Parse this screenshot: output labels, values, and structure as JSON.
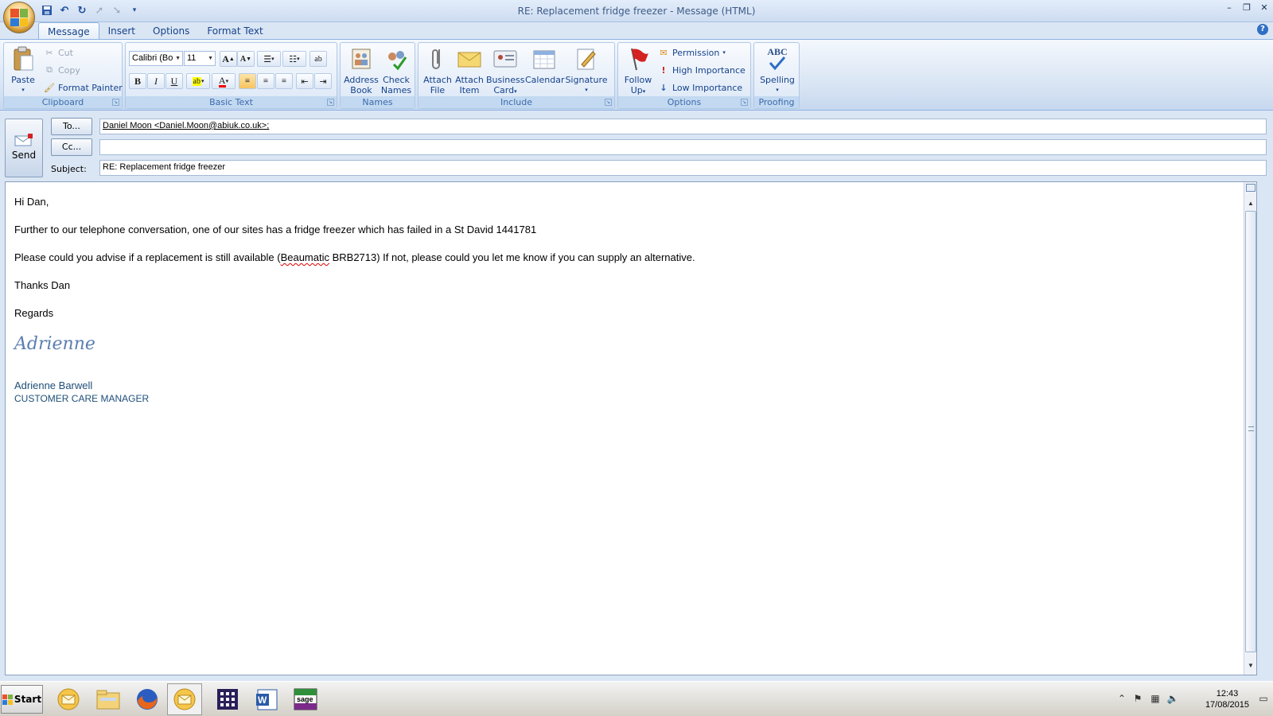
{
  "window": {
    "title": "RE: Replacement fridge freezer - Message (HTML)"
  },
  "qat": {
    "icons": [
      "save-icon",
      "undo-icon",
      "redo-icon",
      "up-arrow-icon",
      "down-arrow-icon",
      "customize-qat-icon"
    ]
  },
  "tabs": [
    "Message",
    "Insert",
    "Options",
    "Format Text"
  ],
  "ribbon": {
    "clipboard": {
      "label": "Clipboard",
      "paste": "Paste",
      "cut": "Cut",
      "copy": "Copy",
      "format_painter": "Format Painter"
    },
    "basic_text": {
      "label": "Basic Text",
      "font": "Calibri (Bo",
      "size": "11"
    },
    "names": {
      "label": "Names",
      "address_book": [
        "Address",
        "Book"
      ],
      "check_names": [
        "Check",
        "Names"
      ]
    },
    "include": {
      "label": "Include",
      "attach_file": [
        "Attach",
        "File"
      ],
      "attach_item": [
        "Attach",
        "Item"
      ],
      "business_card": [
        "Business",
        "Card"
      ],
      "calendar": "Calendar",
      "signature": "Signature"
    },
    "options": {
      "label": "Options",
      "follow_up": [
        "Follow",
        "Up"
      ],
      "permission": "Permission",
      "high_importance": "High Importance",
      "low_importance": "Low Importance"
    },
    "proofing": {
      "label": "Proofing",
      "spelling": "Spelling",
      "abc": "ABC"
    }
  },
  "header": {
    "send": "Send",
    "to_btn": "To...",
    "cc_btn": "Cc...",
    "subject_label": "Subject:",
    "to_value": "Daniel Moon <Daniel.Moon@abiuk.co.uk>;",
    "cc_value": "",
    "subject_value": "RE: Replacement fridge freezer"
  },
  "body": {
    "greeting": "Hi Dan,",
    "para1": "Further to our telephone conversation, one of our sites has a fridge freezer which has failed in a St David 1441781",
    "para2_pre": "Please could you advise if a replacement is still available (",
    "para2_misspelled": "Beaumatic",
    "para2_post": " BRB2713)  If not, please could you let me know if you can supply an  alternative.",
    "thanks": "Thanks Dan",
    "regards": "Regards",
    "signature_script": "Adrienne",
    "signature_name": "Adrienne Barwell",
    "signature_title": "CUSTOMER CARE MANAGER"
  },
  "taskbar": {
    "start": "Start",
    "apps": [
      "outlook-icon",
      "file-explorer-icon",
      "firefox-icon",
      "outlook-compose-icon",
      "calendar-grid-icon",
      "word-icon",
      "sage-icon"
    ],
    "clock_time": "12:43",
    "clock_date": "17/08/2015"
  },
  "colors": {
    "ribbon_text": "#15428b",
    "accent": "#8db2e3"
  }
}
